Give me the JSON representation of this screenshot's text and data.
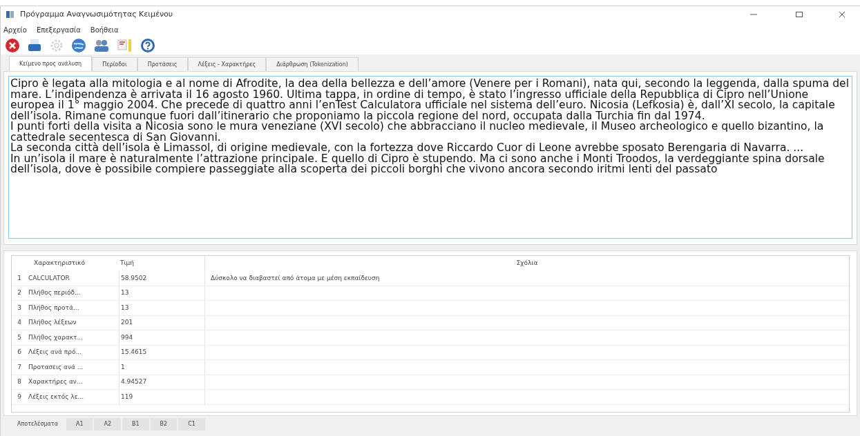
{
  "window": {
    "title": "Πρόγραμμα Αναγνωσιμότητας Κειμένου"
  },
  "menu": [
    "Αρχείο",
    "Επεξεργασία",
    "Βοήθεια"
  ],
  "toolbar": [
    {
      "kind": "close"
    },
    {
      "kind": "save"
    },
    {
      "kind": "gear",
      "disabled": true
    },
    {
      "kind": "globe"
    },
    {
      "kind": "people"
    },
    {
      "kind": "chart"
    },
    {
      "kind": "help"
    }
  ],
  "tabs": [
    {
      "label": "Κείμενο προς ανάλυση",
      "selected": true
    },
    {
      "label": "Περίοδοι",
      "selected": false
    },
    {
      "label": "Προτάσεις",
      "selected": false
    },
    {
      "label": "Λέξεις - Χαρακτήρες",
      "selected": false
    },
    {
      "label": "Διάρθρωση (Tokenization)",
      "selected": false
    }
  ],
  "text": [
    "Cipro è legata alla mitologia e al nome di Afrodite, la dea della bellezza e dell’amore (Venere per i Romani), nata qui, secondo la leggenda, dalla spuma del mare. L’indipendenza è arrivata il 16 agosto 1960. Ultima tappa, in ordine di tempo, è stato l’ingresso ufficiale della Repubblica di Cipro nell’Unione europea il 1° maggio 2004. Che precede di quattro anni l’enTest Calculatora ufficiale nel sistema dell’euro. Nicosia (Lefkosia) è, dall’XI secolo, la capitale dell’isola. Rimane comunque fuori dall’itinerario che proponiamo la piccola regione del nord, occupata dalla Turchia fin dal 1974.",
    "I punti forti della visita a Nicosia sono le mura veneziane (XVI secolo) che abbracciano il nucleo medievale, il Museo archeologico e quello bizantino, la cattedrale secentesca di San Giovanni.",
    "La seconda città dell’isola è Limassol, di origine medievale, con la fortezza dove Riccardo Cuor di Leone avrebbe sposato Berengaria di Navarra. ...",
    "In un’isola il mare è naturalmente l’attrazione principale. E quello di Cipro è stupendo. Ma ci sono anche i Monti Troodos, la verdeggiante spina dorsale dell’isola, dove è possibile compiere passeggiate alla scoperta dei piccoli borghi che vivono ancora secondo iritmi lenti del passato"
  ],
  "table": {
    "columns": [
      "Χαρακτηριστικό",
      "Τιμή",
      "Σχόλια"
    ],
    "rows": [
      {
        "n": "1",
        "feature": "CALCULATOR",
        "value": "58.9502",
        "comment": "Δύσκολο να διαβαστεί από άτομα με μέση εκπαίδευση"
      },
      {
        "n": "2",
        "feature": "Πλήθος περιόδ...",
        "value": "13"
      },
      {
        "n": "3",
        "feature": "Πλήθος προτά...",
        "value": "13"
      },
      {
        "n": "4",
        "feature": "Πλήθος λέξεων",
        "value": "201"
      },
      {
        "n": "5",
        "feature": "Πλήθος χαρακτ...",
        "value": "994"
      },
      {
        "n": "6",
        "feature": "Λέξεις ανά πρό...",
        "value": "15.4615"
      },
      {
        "n": "7",
        "feature": "Προτασεις ανά ...",
        "value": "1"
      },
      {
        "n": "8",
        "feature": "Χαρακτήρες αν...",
        "value": "4.94527"
      },
      {
        "n": "9",
        "feature": "Λέξεις εκτός λε...",
        "value": "119"
      }
    ]
  },
  "bottom_tabs": [
    {
      "label": "Αποτελέσματα",
      "selected": true
    },
    {
      "label": "A1",
      "selected": false
    },
    {
      "label": "A2",
      "selected": false
    },
    {
      "label": "B1",
      "selected": false
    },
    {
      "label": "B2",
      "selected": false
    },
    {
      "label": "C1",
      "selected": false
    }
  ]
}
